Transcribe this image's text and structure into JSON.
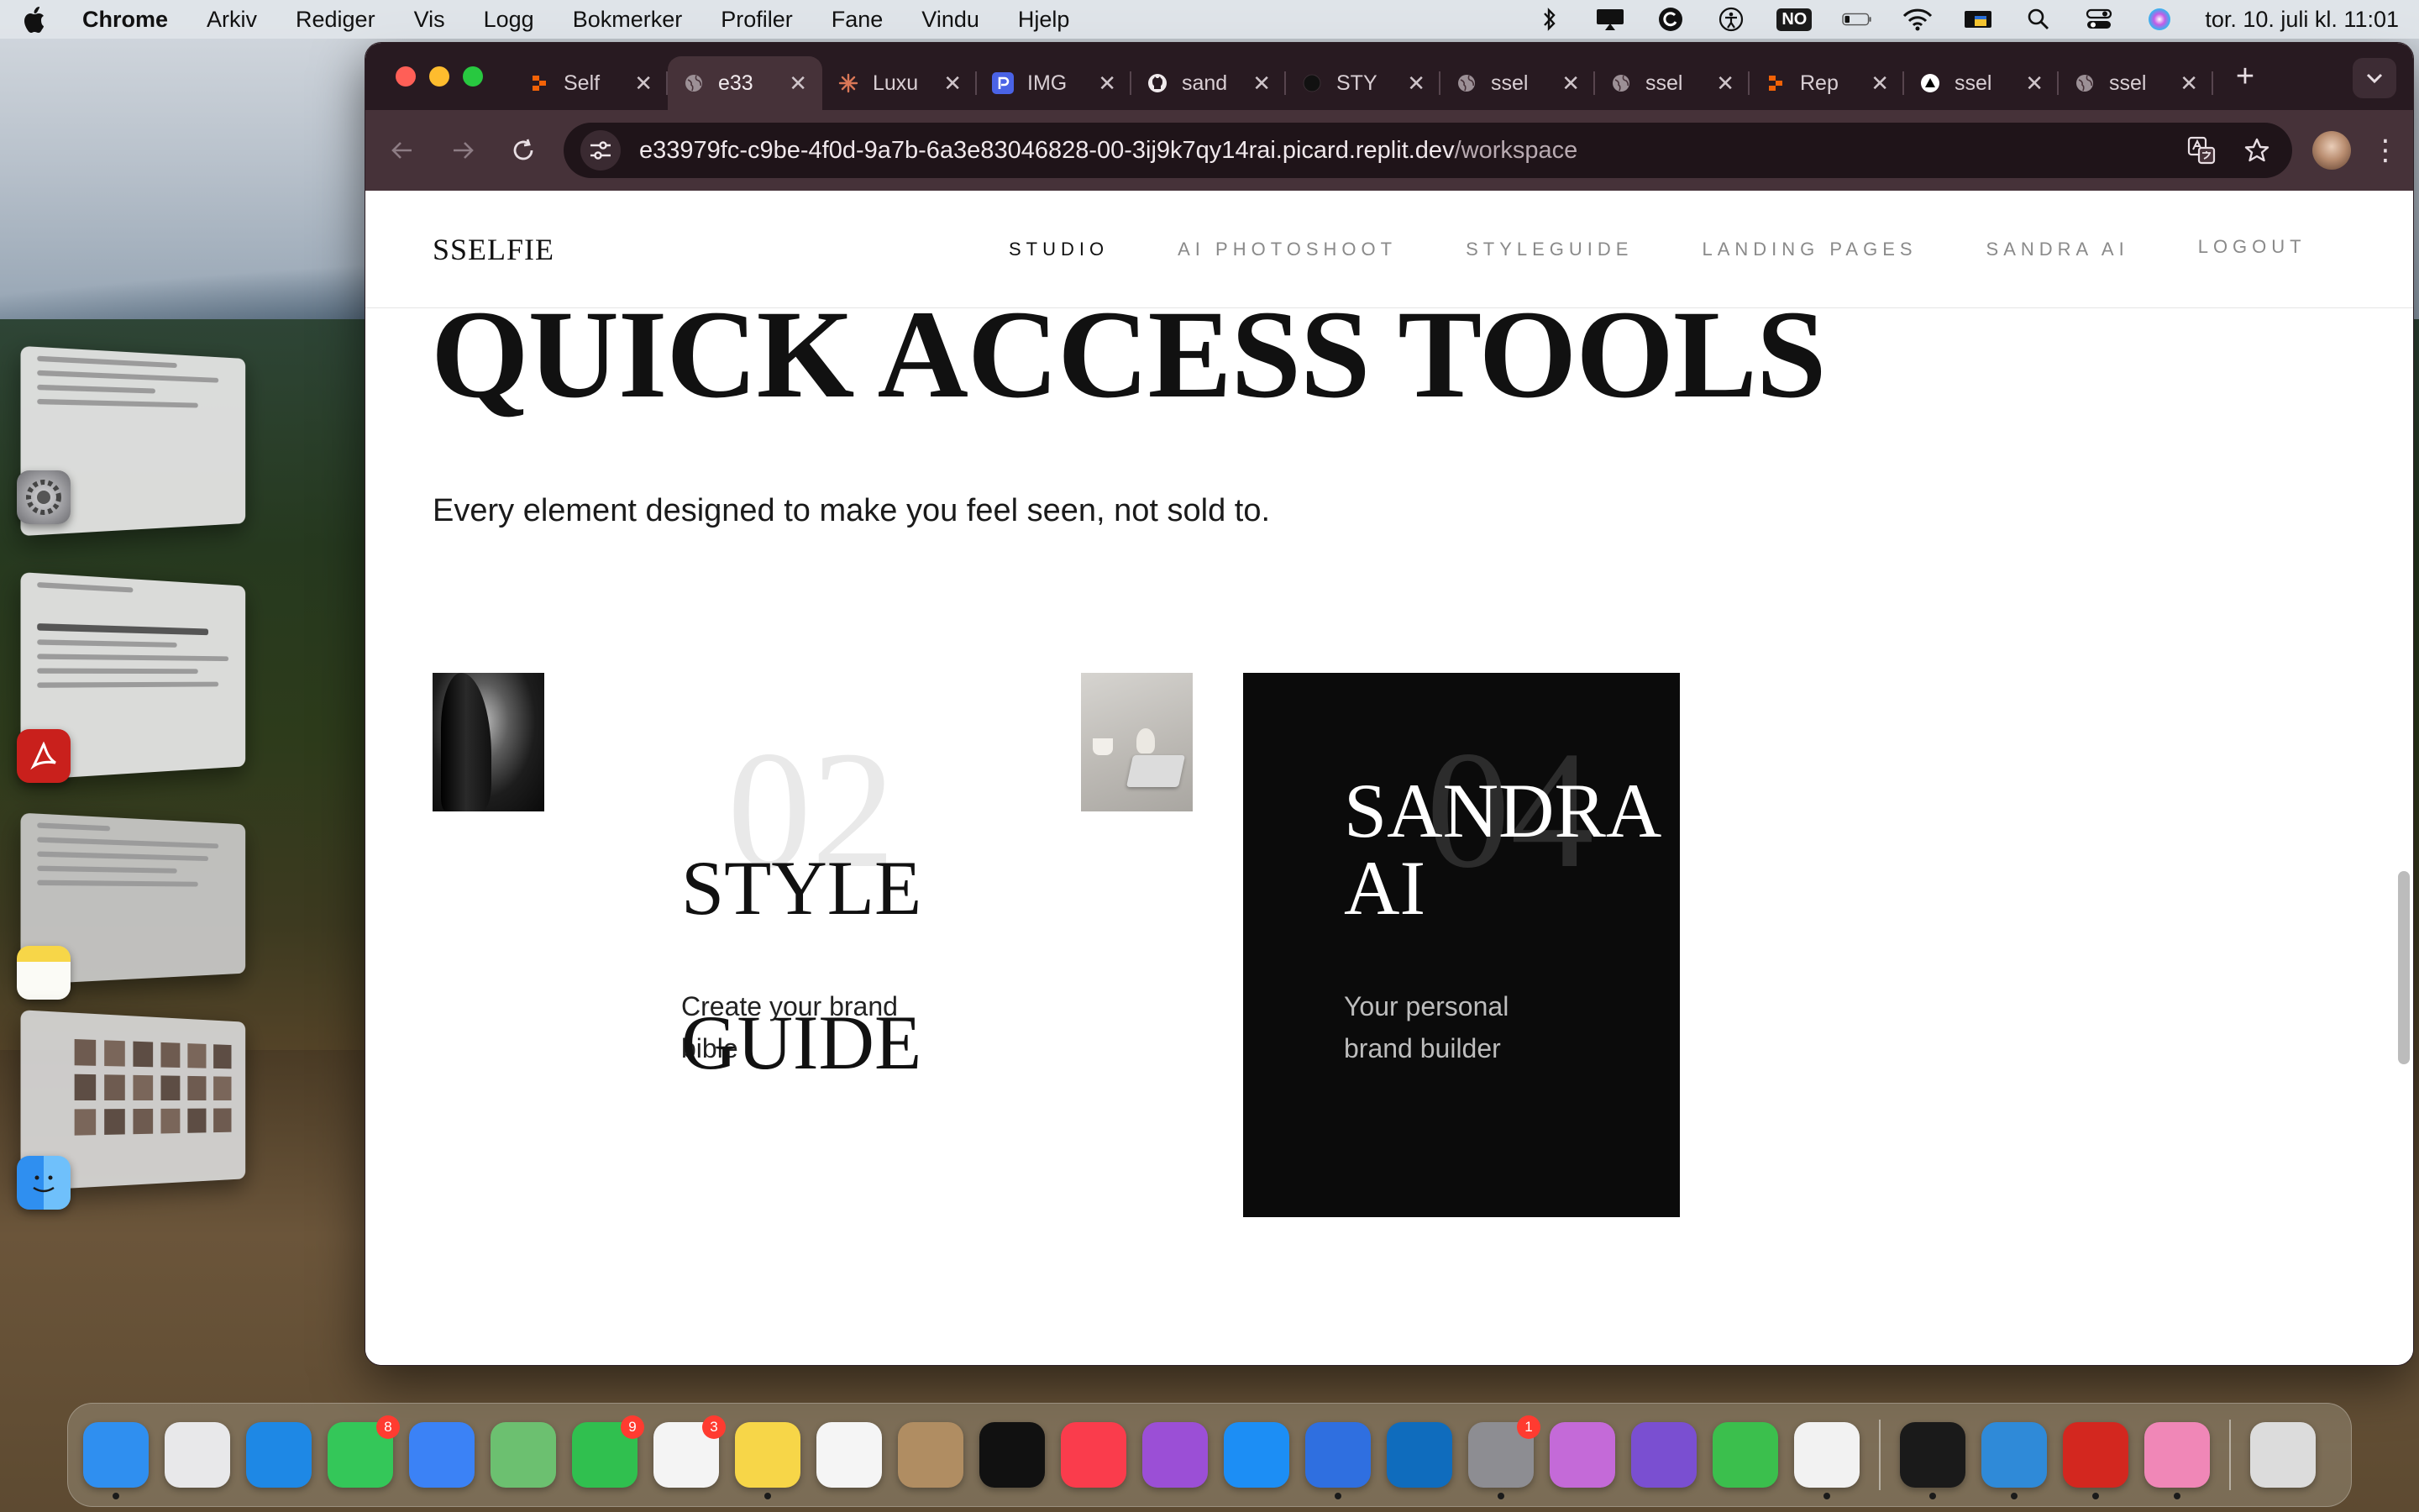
{
  "menubar": {
    "app_name": "Chrome",
    "menus": [
      "Arkiv",
      "Rediger",
      "Vis",
      "Logg",
      "Bokmerker",
      "Profiler",
      "Fane",
      "Vindu",
      "Hjelp"
    ],
    "input_source_label": "NO",
    "clock": "tor. 10. juli kl. 11:01"
  },
  "browser": {
    "tabs": [
      {
        "title": "Self",
        "favicon": "replit-icon",
        "active": false
      },
      {
        "title": "e33",
        "favicon": "globe-icon",
        "active": true
      },
      {
        "title": "Luxu",
        "favicon": "claude-icon",
        "active": false
      },
      {
        "title": "IMG",
        "favicon": "picsart-icon",
        "active": false
      },
      {
        "title": "sand",
        "favicon": "github-icon",
        "active": false
      },
      {
        "title": "STY",
        "favicon": "dark-circle-icon",
        "active": false
      },
      {
        "title": "ssel",
        "favicon": "globe-icon",
        "active": false
      },
      {
        "title": "ssel",
        "favicon": "globe-icon",
        "active": false
      },
      {
        "title": "Rep",
        "favicon": "replit-icon",
        "active": false
      },
      {
        "title": "ssel",
        "favicon": "vercel-icon",
        "active": false
      },
      {
        "title": "ssel",
        "favicon": "globe-icon",
        "active": false
      }
    ],
    "url_host": "e33979fc-c9be-4f0d-9a7b-6a3e83046828-00-3ij9k7qy14rai.picard.replit.dev",
    "url_path": "/workspace"
  },
  "site": {
    "logo": "SSELFIE",
    "nav": [
      {
        "label": "STUDIO",
        "current": true
      },
      {
        "label": "AI PHOTOSHOOT",
        "current": false
      },
      {
        "label": "STYLEGUIDE",
        "current": false
      },
      {
        "label": "LANDING PAGES",
        "current": false
      },
      {
        "label": "SANDRA AI",
        "current": false
      },
      {
        "label": "LOGOUT",
        "current": false
      }
    ],
    "hero_title": "QUICK ACCESS TOOLS",
    "hero_subtitle": "Every element designed to make you feel seen, not sold to.",
    "cards": [
      {
        "number": "02",
        "title": "STYLE\nGUIDE",
        "title_lines": [
          "STYLE",
          "GUIDE"
        ],
        "description": "Create your brand bible",
        "theme": "light"
      },
      {
        "number": "04",
        "title": "SANDRA\nAI",
        "title_lines": [
          "SANDRA",
          "AI"
        ],
        "description": "Your personal brand builder",
        "theme": "dark"
      }
    ]
  },
  "dock": {
    "items": [
      {
        "name": "finder",
        "color": "#2f8ff0",
        "running": true
      },
      {
        "name": "launchpad",
        "color": "#e8e8ea",
        "running": false
      },
      {
        "name": "safari",
        "color": "#1e88e5",
        "running": false
      },
      {
        "name": "messages",
        "color": "#34c759",
        "badge": "8",
        "running": false
      },
      {
        "name": "mail",
        "color": "#3b82f6",
        "running": false
      },
      {
        "name": "maps",
        "color": "#6cc070",
        "running": false
      },
      {
        "name": "facetime",
        "color": "#30c04f",
        "badge": "9",
        "running": false
      },
      {
        "name": "reminders",
        "color": "#f4f4f4",
        "badge": "3",
        "running": false
      },
      {
        "name": "notes",
        "color": "#f7d648",
        "running": true
      },
      {
        "name": "freeform",
        "color": "#f5f5f5",
        "running": false
      },
      {
        "name": "contacts",
        "color": "#b08d62",
        "running": false
      },
      {
        "name": "apple-tv",
        "color": "#111111",
        "running": false
      },
      {
        "name": "music",
        "color": "#fa3c4c",
        "running": false
      },
      {
        "name": "podcasts",
        "color": "#9b4fd6",
        "running": false
      },
      {
        "name": "app-store",
        "color": "#1c8ef5",
        "running": false
      },
      {
        "name": "screens",
        "color": "#2f6fe0",
        "running": true
      },
      {
        "name": "outlook",
        "color": "#0f6cbd",
        "running": false
      },
      {
        "name": "system-settings",
        "color": "#8d8d92",
        "badge": "1",
        "running": true
      },
      {
        "name": "keynote",
        "color": "#c46ad8",
        "running": false
      },
      {
        "name": "github-desktop",
        "color": "#7a4fd1",
        "running": false
      },
      {
        "name": "numbers",
        "color": "#3bbf4d",
        "running": false
      },
      {
        "name": "chrome",
        "color": "#f2f2f2",
        "running": true
      },
      {
        "name": "separator"
      },
      {
        "name": "cursor",
        "color": "#1a1a1a",
        "running": true
      },
      {
        "name": "vscode",
        "color": "#2f8ad8",
        "running": true
      },
      {
        "name": "acrobat",
        "color": "#d3271f",
        "running": true
      },
      {
        "name": "keynote-pink",
        "color": "#f087b7",
        "running": true
      },
      {
        "name": "separator"
      },
      {
        "name": "trash",
        "color": "#dcdcdc",
        "running": false
      }
    ]
  }
}
